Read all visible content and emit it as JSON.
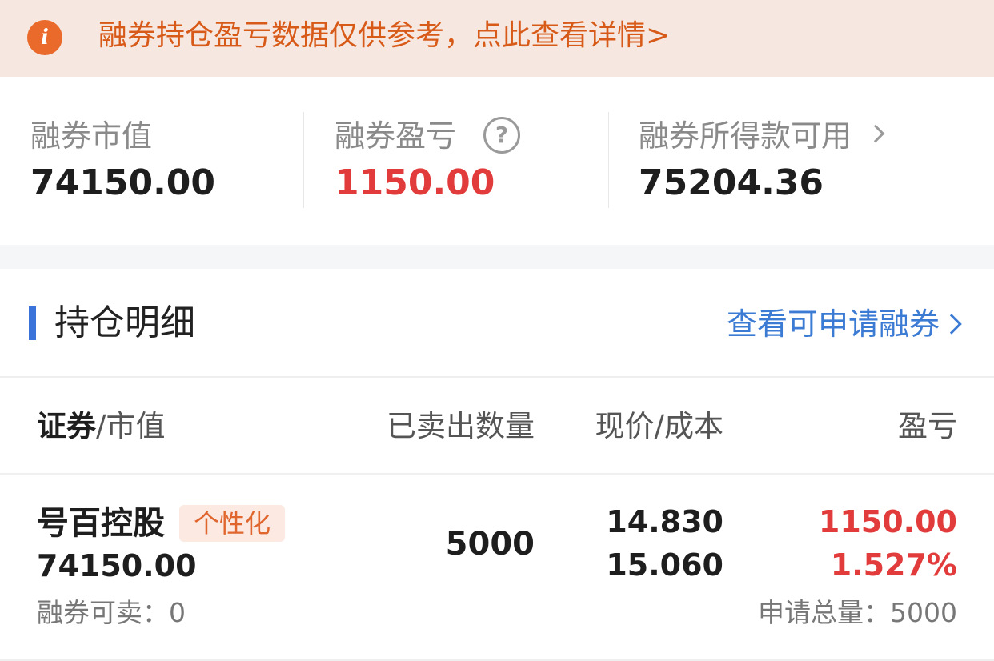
{
  "notice": {
    "icon": "info-icon",
    "text": "融券持仓盈亏数据仅供参考，点此查看详情>"
  },
  "summary": {
    "market_value_label": "融券市值",
    "market_value": "74150.00",
    "profit_label": "融券盈亏",
    "profit": "1150.00",
    "proceeds_label": "融券所得款可用",
    "proceeds": "75204.36"
  },
  "holdings": {
    "title": "持仓明细",
    "link": "查看可申请融券"
  },
  "table": {
    "col1_strong": "证券",
    "col1_rest": "/市值",
    "col2": "已卖出数量",
    "col3": "现价/成本",
    "col4": "盈亏"
  },
  "rows": [
    {
      "name": "号百控股",
      "tag": "个性化",
      "market_value": "74150.00",
      "sellable": "融券可卖：0",
      "sold_qty": "5000",
      "price": "14.830",
      "cost": "15.060",
      "pl": "1150.00",
      "pl_pct": "1.527%",
      "apply_total": "申请总量：5000"
    }
  ],
  "colors": {
    "accent_blue": "#3b7bd4",
    "profit_red": "#e23b3b",
    "notice_orange": "#d85a18"
  }
}
